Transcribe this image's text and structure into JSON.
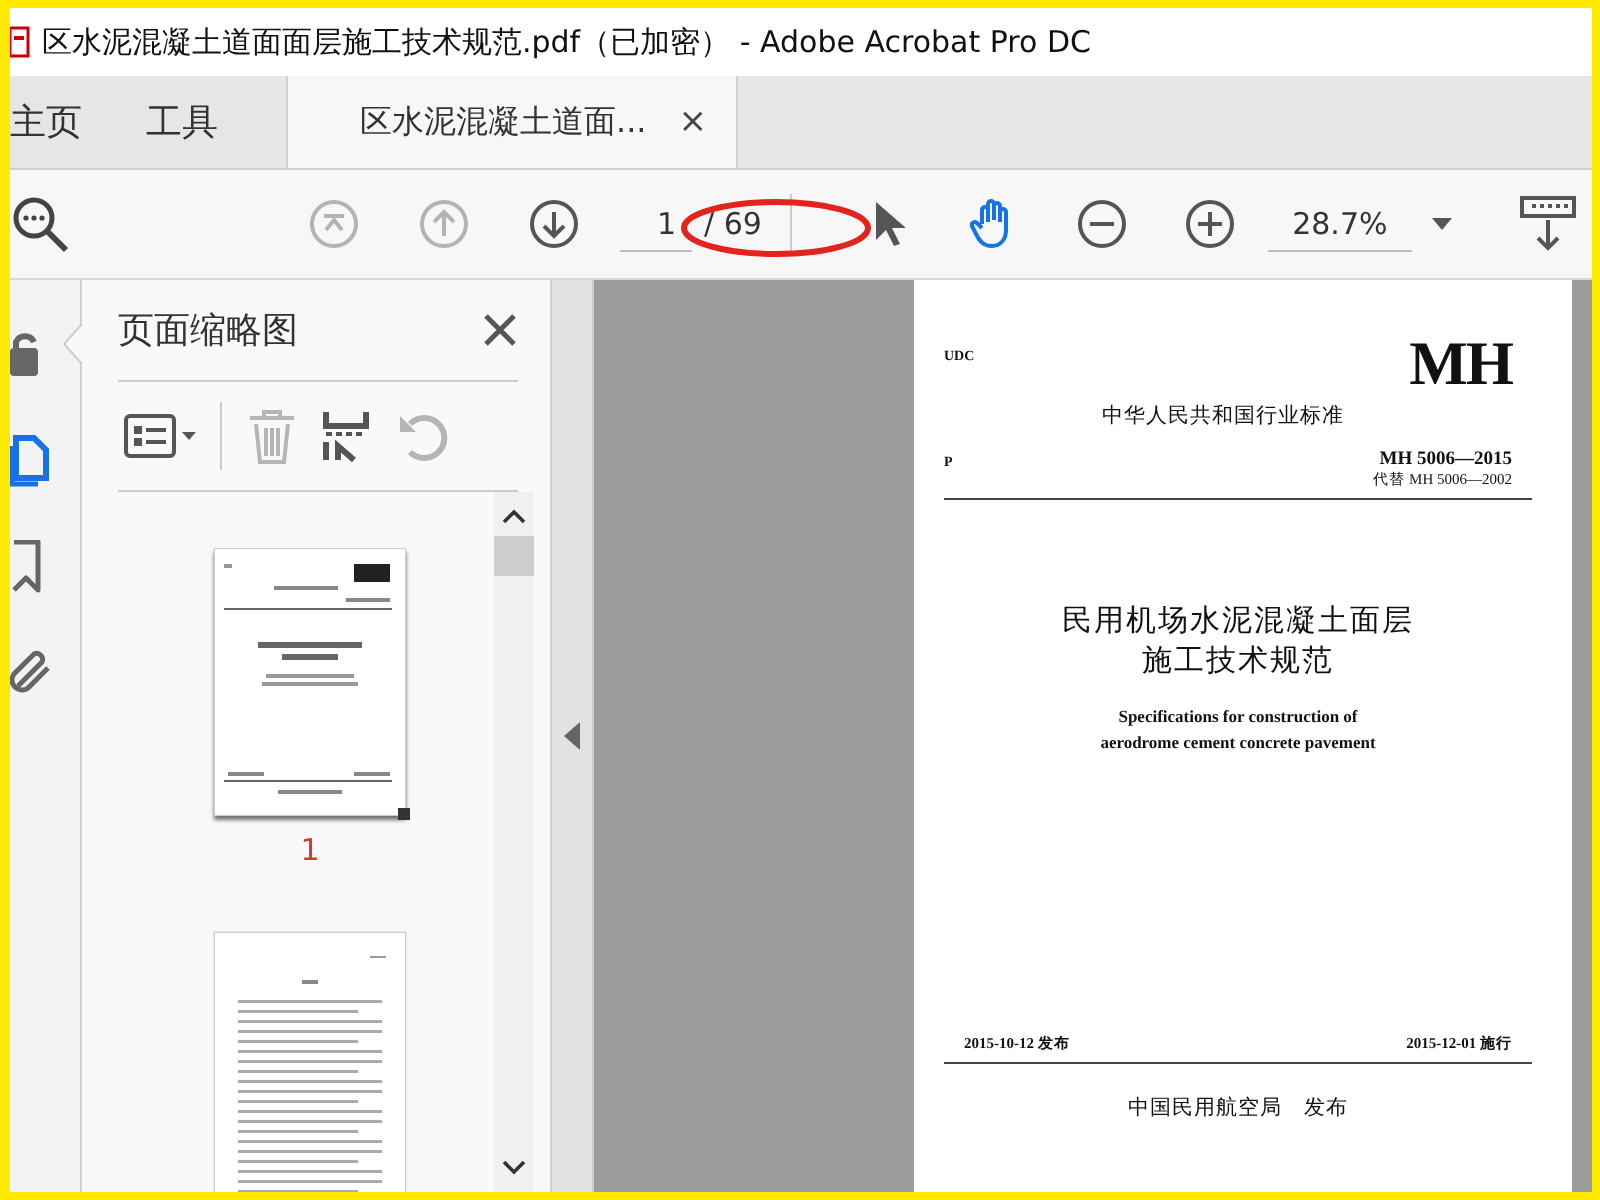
{
  "window": {
    "title": "区水泥混凝土道面面层施工技术规范.pdf（已加密） - Adobe Acrobat Pro DC"
  },
  "tabs": [
    {
      "label": "主页",
      "selected": false
    },
    {
      "label": "工具",
      "selected": false
    },
    {
      "label": "区水泥混凝土道面...",
      "selected": true,
      "close": "×"
    }
  ],
  "toolbar": {
    "nav": [
      {
        "kind": "first",
        "disabled": true
      },
      {
        "kind": "prev",
        "disabled": true
      },
      {
        "kind": "next",
        "disabled": false
      }
    ],
    "page_number": "1",
    "page_total": "/ 69",
    "tools": [
      {
        "kind": "select",
        "selected": false
      },
      {
        "kind": "hand",
        "selected": true
      }
    ],
    "zoom": "28.7%"
  },
  "side_rail": [
    {
      "kind": "lock",
      "selected": false
    },
    {
      "kind": "pages",
      "selected": true
    },
    {
      "kind": "bookmark",
      "selected": false
    },
    {
      "kind": "attachment",
      "selected": false
    }
  ],
  "thumbnails_panel": {
    "title": "页面缩略图",
    "tools": [
      {
        "kind": "options",
        "disabled": false
      },
      {
        "kind": "delete",
        "disabled": true
      },
      {
        "kind": "extract",
        "disabled": false
      },
      {
        "kind": "rotate",
        "disabled": true
      }
    ],
    "thumbnails": [
      {
        "kind": "cover",
        "label": "1",
        "selected": true
      },
      {
        "kind": "text",
        "selected": false
      }
    ]
  },
  "document": {
    "udc": "UDC",
    "logo": "MH",
    "standard_type": "中华人民共和国行业标准",
    "class": "P",
    "code": "MH 5006—2015",
    "replaces": "代替 MH 5006—2002",
    "title_lines": [
      "民用机场水泥混凝土面层",
      "施工技术规范"
    ],
    "english_lines": [
      "Specifications for construction of",
      "aerodrome cement concrete pavement"
    ],
    "issued": "2015-10-12 发布",
    "effective": "2015-12-01 施行",
    "publisher": "中国民用航空局　发布"
  }
}
